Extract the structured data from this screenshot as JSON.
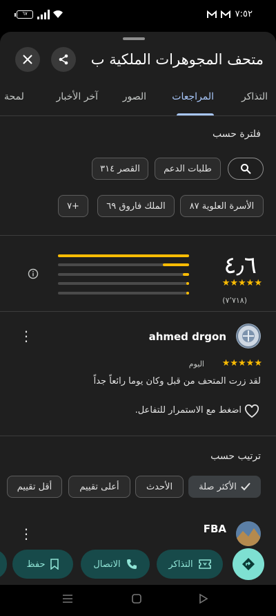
{
  "status_bar": {
    "time": "٧:٥٢",
    "battery": "٦٧"
  },
  "header": {
    "title": "متحف المجوهرات الملكية ب.."
  },
  "tabs": [
    "التذاكر",
    "المراجعات",
    "الصور",
    "آخر الأخبار",
    "لمحة"
  ],
  "filter": {
    "title": "فلترة حسب",
    "chips_row1": [
      "طلبات الدعم",
      "القصر ٣١٤"
    ],
    "chips_row2": [
      "الأسرة العلوية ٨٧",
      "الملك فاروق ٦٩",
      "+٧"
    ]
  },
  "rating": {
    "average": "٤٫٦",
    "count": "(٧٬٧١٨)",
    "stars": "★★★★★",
    "distribution": [
      {
        "stars": 5,
        "fraction": 1.0
      },
      {
        "stars": 4,
        "fraction": 0.2
      },
      {
        "stars": 3,
        "fraction": 0.05
      },
      {
        "stars": 2,
        "fraction": 0.02
      },
      {
        "stars": 1,
        "fraction": 0.02
      }
    ]
  },
  "review": {
    "author": "ahmed drgon",
    "stars": "★★★★★",
    "when": "اليوم",
    "text": "لقد زرت المتحف من قبل وكان يوما رائعاً جداً",
    "tap_to_engage": "اضغط مع الاستمرار للتفاعل."
  },
  "sort": {
    "title": "ترتيب حسب",
    "options": [
      "الأكثر صلة",
      "الأحدث",
      "أعلى تقييم",
      "أقل تقييم"
    ],
    "selected": "الأكثر صلة"
  },
  "next_review": {
    "author": "FBA"
  },
  "actions": {
    "tickets": "التذاكر",
    "call": "الاتصال",
    "save": "حفظ"
  },
  "colors": {
    "accent_tab": "#a8c7fa",
    "star": "#fbbc04",
    "action_bg": "#174a4a",
    "action_text": "#8fe3d5"
  }
}
